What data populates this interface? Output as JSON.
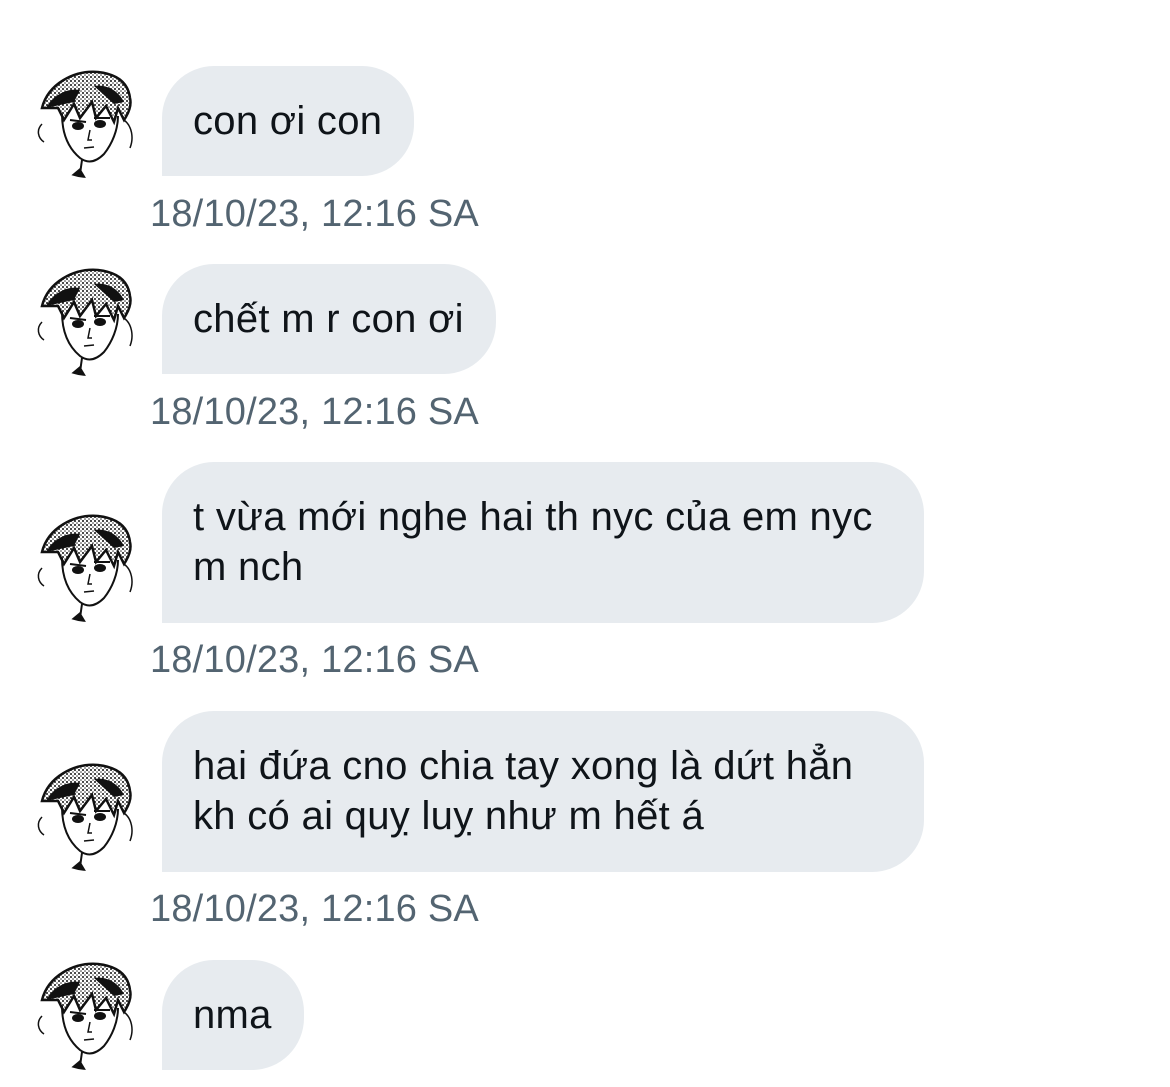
{
  "messages": [
    {
      "text": "con ơi con",
      "time": "18/10/23, 12:16 SA",
      "avatar_icon": "manga-boy-avatar-icon"
    },
    {
      "text": "chết m r con ơi",
      "time": "18/10/23, 12:16 SA",
      "avatar_icon": "manga-boy-avatar-icon"
    },
    {
      "text": "t vừa mới nghe hai th nyc của em nyc m nch",
      "time": "18/10/23, 12:16 SA",
      "avatar_icon": "manga-boy-avatar-icon"
    },
    {
      "text": "hai đứa cno chia tay xong là dứt hẳn kh có ai quỵ luỵ như m hết á",
      "time": "18/10/23, 12:16 SA",
      "avatar_icon": "manga-boy-avatar-icon"
    },
    {
      "text": "nma",
      "avatar_icon": "manga-boy-avatar-icon"
    }
  ],
  "colors": {
    "bubble_background": "#e7ebef",
    "message_text": "#0f1419",
    "timestamp_text": "#536471",
    "page_background": "#ffffff"
  }
}
